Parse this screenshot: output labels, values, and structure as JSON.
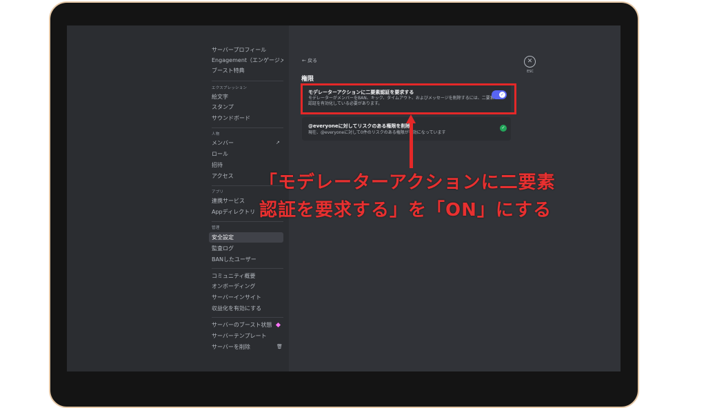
{
  "sidebar": {
    "group_server": [
      {
        "label": "サーバープロフィール"
      },
      {
        "label": "Engagement（エンゲージメ..."
      },
      {
        "label": "ブースト特典"
      }
    ],
    "expression_header": "エクスプレッション",
    "group_expression": [
      {
        "label": "絵文字"
      },
      {
        "label": "スタンプ"
      },
      {
        "label": "サウンドボード"
      }
    ],
    "people_header": "人物",
    "group_people": [
      {
        "label": "メンバー"
      },
      {
        "label": "ロール"
      },
      {
        "label": "招待"
      },
      {
        "label": "アクセス"
      }
    ],
    "apps_header": "アプリ",
    "group_apps": [
      {
        "label": "連携サービス"
      },
      {
        "label": "Appディレクトリ"
      }
    ],
    "moderation_header": "管理",
    "group_moderation": [
      {
        "label": "安全設定"
      },
      {
        "label": "監査ログ"
      },
      {
        "label": "BANしたユーザー"
      }
    ],
    "group_community": [
      {
        "label": "コミュニティ概要"
      },
      {
        "label": "オンボーディング"
      },
      {
        "label": "サーバーインサイト"
      },
      {
        "label": "収益化を有効にする"
      }
    ],
    "group_bottom": [
      {
        "label": "サーバーのブースト状態"
      },
      {
        "label": "サーバーテンプレート"
      },
      {
        "label": "サーバーを削除"
      }
    ],
    "icons": {
      "members": "external-link-icon",
      "boost": "boost-gem-icon",
      "delete": "trash-icon"
    }
  },
  "main": {
    "back_label": "← 戻る",
    "esc_label": "ESC",
    "section_title": "権限",
    "permissions": [
      {
        "title": "モデレーターアクションに二要素認証を要求する",
        "description": "モデレーターがメンバーをBAN、キック、タイムアウト、およびメッセージを削除するには、二要素認証を有効化している必要があります。",
        "toggle_on": true
      },
      {
        "title": "@everyoneに対してリスクのある権限を削除",
        "description": "現在、@everyoneに対して0件のリスクのある権限が有効になっています",
        "status": "ok"
      }
    ]
  },
  "annotation": {
    "line1": "「モデレーターアクションに二要素",
    "line2": "認証を要求する」を「ON」にする",
    "color": "#e52828"
  },
  "colors": {
    "accent": "#5865f2",
    "success": "#23a55a",
    "sidebar_bg": "#2b2d31",
    "main_bg": "#313338"
  }
}
